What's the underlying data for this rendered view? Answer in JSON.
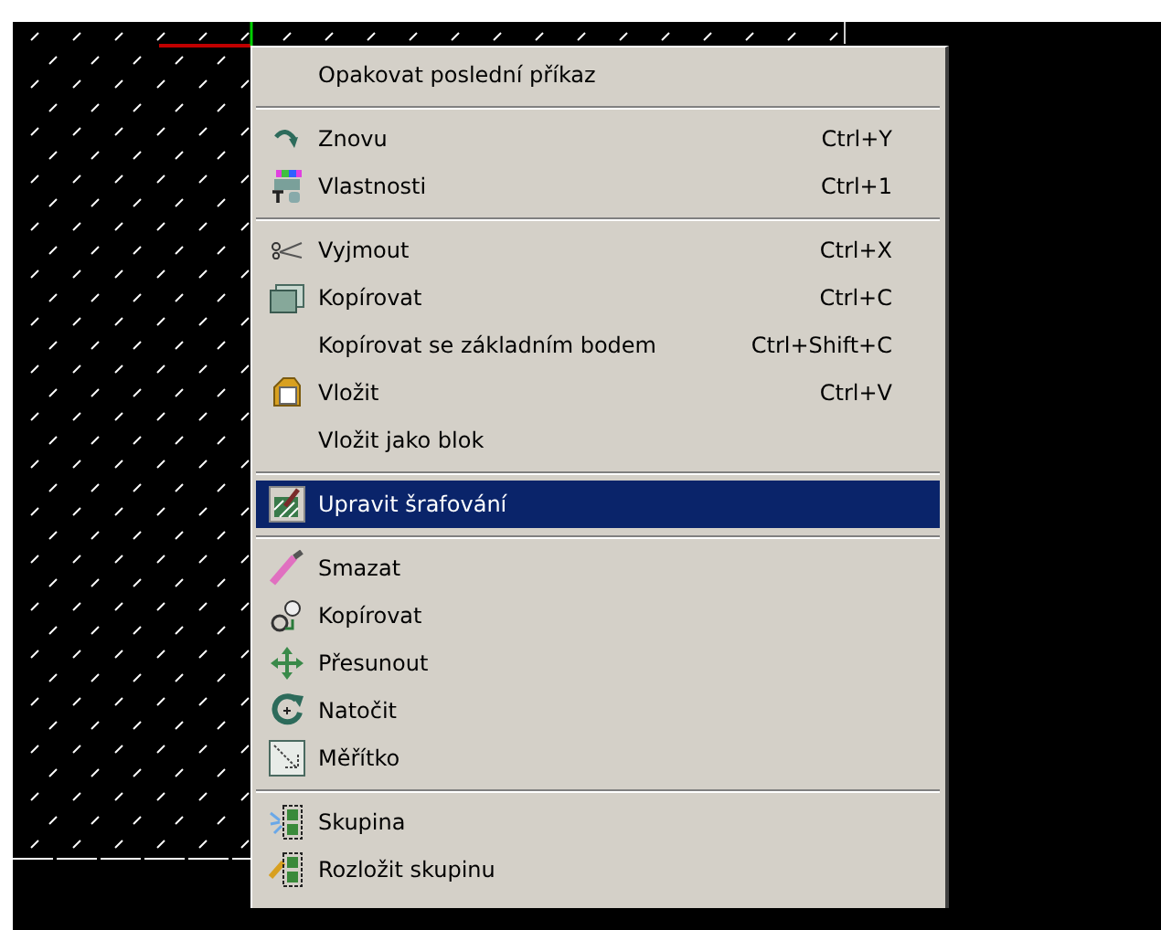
{
  "context_menu": {
    "groups": [
      [
        {
          "label": "Opakovat poslední příkaz",
          "selected": false
        }
      ],
      [
        {
          "label": "Znovu",
          "shortcut": "Ctrl+Y",
          "selected": false
        },
        {
          "label": "Vlastnosti",
          "shortcut": "Ctrl+1",
          "selected": false
        }
      ],
      [
        {
          "label": "Vyjmout",
          "shortcut": "Ctrl+X",
          "selected": false
        },
        {
          "label": "Kopírovat",
          "shortcut": "Ctrl+C",
          "selected": false
        },
        {
          "label": "Kopírovat se základním bodem",
          "shortcut": "Ctrl+Shift+C",
          "selected": false
        },
        {
          "label": "Vložit",
          "shortcut": "Ctrl+V",
          "selected": false
        },
        {
          "label": "Vložit jako blok",
          "selected": false
        }
      ],
      [
        {
          "label": "Upravit šrafování",
          "selected": true
        }
      ],
      [
        {
          "label": "Smazat",
          "selected": false
        },
        {
          "label": "Kopírovat",
          "selected": false
        },
        {
          "label": "Přesunout",
          "selected": false
        },
        {
          "label": "Natočit",
          "selected": false
        },
        {
          "label": "Měřítko",
          "selected": false
        }
      ],
      [
        {
          "label": "Skupina",
          "selected": false
        },
        {
          "label": "Rozložit skupinu",
          "selected": false
        }
      ]
    ]
  }
}
